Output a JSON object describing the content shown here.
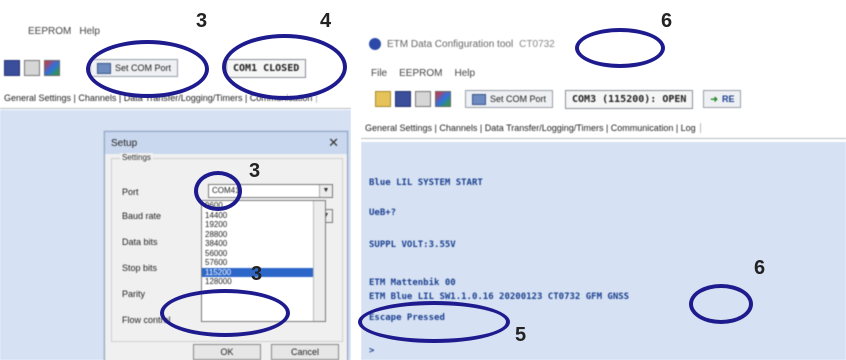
{
  "left_panel": {
    "menu": [
      "EEPROM",
      "Help"
    ],
    "set_com_port_label": "Set COM Port",
    "com_status": "COM1 CLOSED",
    "tabs_text": "General Settings | Channels | Data Transfer/Logging/Timers | Communication",
    "setup_dialog": {
      "title": "Setup",
      "close": "✕",
      "group_label": "Settings",
      "port_label": "Port",
      "port_value": "COM41",
      "baud_label": "Baud rate",
      "baud_value": "9600",
      "data_bits_label": "Data bits",
      "stop_bits_label": "Stop bits",
      "parity_label": "Parity",
      "flow_control_label": "Flow control",
      "baud_options": [
        "9600",
        "14400",
        "19200",
        "28800",
        "38400",
        "56000",
        "57600",
        "115200",
        "128000"
      ],
      "selected_option": "115200",
      "ok": "OK",
      "cancel": "Cancel"
    }
  },
  "right_panel": {
    "window_title": "ETM Data Configuration tool",
    "title_suffix": "CT0732",
    "menu": [
      "File",
      "EEPROM",
      "Help"
    ],
    "set_com_port_label": "Set COM Port",
    "com_status": "COM3 (115200): OPEN",
    "extra_button": "RE",
    "tabs_text": "General Settings | Channels | Data Transfer/Logging/Timers | Communication | Log",
    "terminal_lines": [
      "Blue LIL SYSTEM START",
      "UeB+?",
      "SUPPL VOLT:3.55V",
      "ETM Mattenbik 00",
      "ETM Blue LIL SW1.1.0.16 20200123 CT0732 GFM GNSS",
      "Escape Pressed",
      ">"
    ]
  },
  "annotations": {
    "labels": [
      "3",
      "4",
      "3",
      "3",
      "6",
      "6",
      "5"
    ],
    "ring_color": "#1e1b8f"
  }
}
